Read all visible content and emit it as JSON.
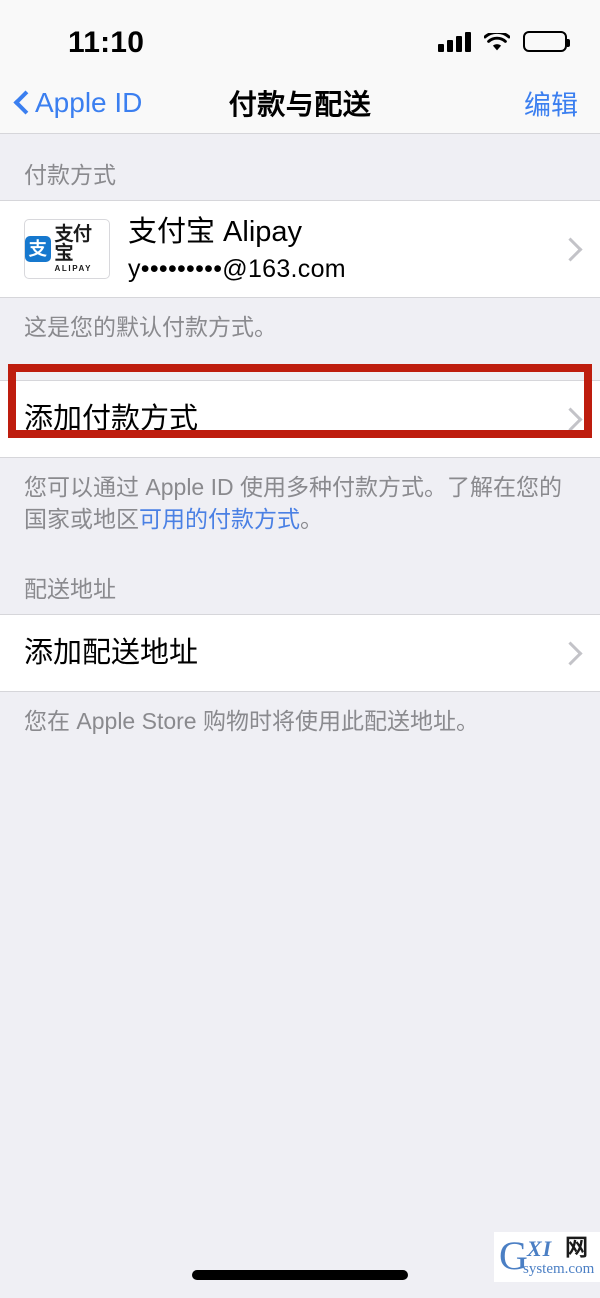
{
  "status_bar": {
    "time": "11:10",
    "signal_icon": "cellular-signal-icon",
    "wifi_icon": "wifi-icon",
    "battery_icon": "battery-full-icon"
  },
  "nav": {
    "back_label": "Apple ID",
    "back_icon": "chevron-left-icon",
    "title": "付款与配送",
    "edit_label": "编辑"
  },
  "payment_section": {
    "header": "付款方式",
    "row": {
      "logo_badge": "支",
      "logo_zh": "支付宝",
      "logo_en": "ALIPAY",
      "title": "支付宝 Alipay",
      "subtitle": "y•••••••••@163.com",
      "chevron_icon": "chevron-right-icon"
    },
    "footer": "这是您的默认付款方式。"
  },
  "add_payment_section": {
    "row_title": "添加付款方式",
    "chevron_icon": "chevron-right-icon",
    "footer_pre": "您可以通过 Apple ID 使用多种付款方式。了解在您的国家或地区",
    "footer_link": "可用的付款方式",
    "footer_post": "。",
    "highlight_color": "#be1d0e"
  },
  "shipping_section": {
    "header": "配送地址",
    "row_title": "添加配送地址",
    "chevron_icon": "chevron-right-icon",
    "footer": "您在 Apple Store 购物时将使用此配送地址。"
  },
  "watermark": {
    "letter": "G",
    "italics": "XI",
    "cjk": "网",
    "domain": "system.com"
  },
  "colors": {
    "accent_blue": "#3b7ff0",
    "link_blue": "#4a80e4",
    "group_bg": "#ffffff",
    "page_bg": "#efeff4",
    "secondary_text": "#8a8a8e",
    "chevron_gray": "#c3c3c8",
    "highlight_red": "#be1d0e"
  }
}
